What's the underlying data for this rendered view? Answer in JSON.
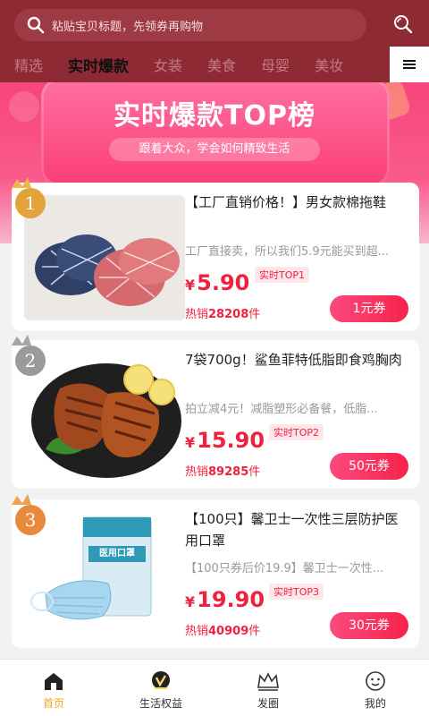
{
  "header": {
    "search_placeholder": "粘贴宝贝标题，先领券再购物",
    "tabs": [
      "精选",
      "实时爆款",
      "女装",
      "美食",
      "母婴",
      "美妆"
    ],
    "active_tab": "实时爆款",
    "bg_color": "#8e2a33"
  },
  "banner": {
    "title": "实时爆款TOP榜",
    "subtitle": "跟着大众，学会如何精致生活"
  },
  "products": [
    {
      "rank": "1",
      "title": "【工厂直销价格！】男女款棉拖鞋",
      "desc": "工厂直接卖，所以我们5.9元能买到超...",
      "currency": "¥",
      "price": "5.90",
      "top_tag": "实时TOP1",
      "sold_prefix": "热销",
      "sold_count": "28208",
      "sold_suffix": "件",
      "coupon": "1元券",
      "badge_color": "#e2a33a"
    },
    {
      "rank": "2",
      "title": "7袋700g！鲨鱼菲特低脂即食鸡胸肉",
      "desc": "拍立减4元！减脂塑形必备餐，低脂...",
      "currency": "¥",
      "price": "15.90",
      "top_tag": "实时TOP2",
      "sold_prefix": "热销",
      "sold_count": "89285",
      "sold_suffix": "件",
      "coupon": "50元券",
      "badge_color": "#9a9a9a"
    },
    {
      "rank": "3",
      "title": "【100只】馨卫士一次性三层防护医用口罩",
      "desc": "【100只券后价19.9】馨卫士一次性...",
      "currency": "¥",
      "price": "19.90",
      "top_tag": "实时TOP3",
      "sold_prefix": "热销",
      "sold_count": "40909",
      "sold_suffix": "件",
      "coupon": "30元券",
      "badge_color": "#e88a3c"
    }
  ],
  "mask_pack_label": "医用口罩",
  "bottom_nav": [
    {
      "label": "首页",
      "icon": "home-icon"
    },
    {
      "label": "生活权益",
      "icon": "vip-icon"
    },
    {
      "label": "发圈",
      "icon": "crown-icon"
    },
    {
      "label": "我的",
      "icon": "profile-icon"
    }
  ],
  "colors": {
    "accent": "#f0203f",
    "nav_active": "#f5a623"
  }
}
